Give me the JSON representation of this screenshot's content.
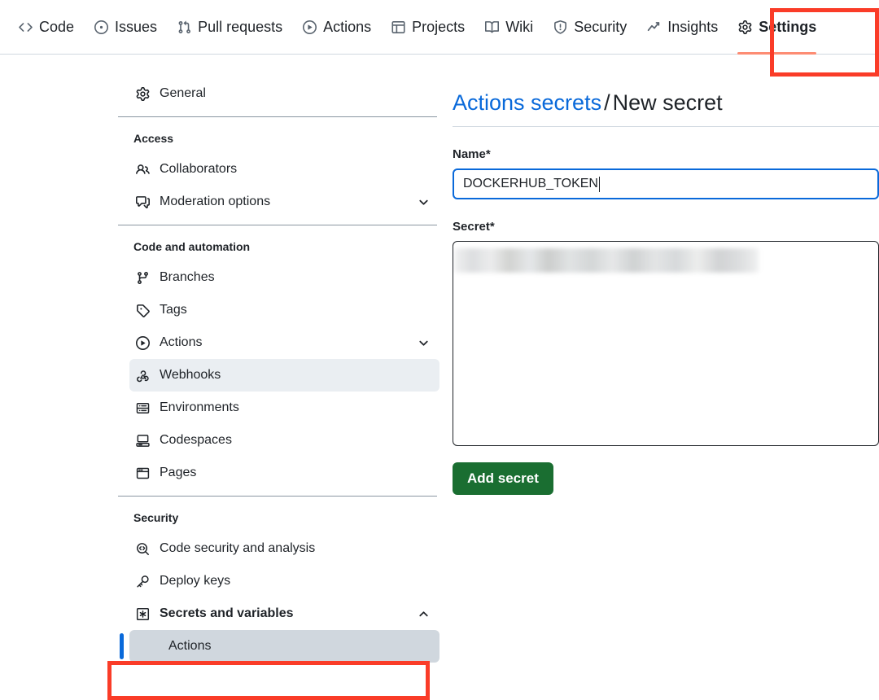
{
  "repo_nav": {
    "tabs": [
      {
        "label": "Code",
        "icon": "code-icon",
        "selected": false
      },
      {
        "label": "Issues",
        "icon": "issue-opened-icon",
        "selected": false
      },
      {
        "label": "Pull requests",
        "icon": "git-pull-request-icon",
        "selected": false
      },
      {
        "label": "Actions",
        "icon": "play-icon",
        "selected": false
      },
      {
        "label": "Projects",
        "icon": "table-icon",
        "selected": false
      },
      {
        "label": "Wiki",
        "icon": "book-icon",
        "selected": false
      },
      {
        "label": "Security",
        "icon": "shield-icon",
        "selected": false
      },
      {
        "label": "Insights",
        "icon": "graph-icon",
        "selected": false
      },
      {
        "label": "Settings",
        "icon": "gear-icon",
        "selected": true
      }
    ],
    "active_tab_underline_color": "#fd8c73"
  },
  "annotations": {
    "color": "#fa3c28",
    "boxes": [
      {
        "target": "Settings"
      },
      {
        "target": "Actions"
      }
    ]
  },
  "sidebar": {
    "top_item": {
      "label": "General",
      "icon": "gear-icon"
    },
    "groups": [
      {
        "title": "Access",
        "items": [
          {
            "label": "Collaborators",
            "icon": "people-icon",
            "chevron": "",
            "state": ""
          },
          {
            "label": "Moderation options",
            "icon": "comment-discussion-icon",
            "chevron": "down",
            "state": ""
          }
        ]
      },
      {
        "title": "Code and automation",
        "items": [
          {
            "label": "Branches",
            "icon": "git-branch-icon",
            "chevron": "",
            "state": ""
          },
          {
            "label": "Tags",
            "icon": "tag-icon",
            "chevron": "",
            "state": ""
          },
          {
            "label": "Actions",
            "icon": "play-icon",
            "chevron": "down",
            "state": ""
          },
          {
            "label": "Webhooks",
            "icon": "webhook-icon",
            "chevron": "",
            "state": "hovered"
          },
          {
            "label": "Environments",
            "icon": "server-icon",
            "chevron": "",
            "state": ""
          },
          {
            "label": "Codespaces",
            "icon": "codespaces-icon",
            "chevron": "",
            "state": ""
          },
          {
            "label": "Pages",
            "icon": "browser-icon",
            "chevron": "",
            "state": ""
          }
        ]
      },
      {
        "title": "Security",
        "items": [
          {
            "label": "Code security and analysis",
            "icon": "codescan-icon",
            "chevron": "",
            "state": ""
          },
          {
            "label": "Deploy keys",
            "icon": "key-icon",
            "chevron": "",
            "state": ""
          },
          {
            "label": "Secrets and variables",
            "icon": "asterisk-box-icon",
            "chevron": "up",
            "state": "bold"
          }
        ],
        "sub_items": [
          {
            "label": "Actions",
            "selected": true
          }
        ]
      }
    ],
    "selected_bar_color": "#0969da",
    "selected_bg_color": "#d0d7de",
    "hover_bg_color": "#eaeef2"
  },
  "main": {
    "breadcrumb": {
      "parent": "Actions secrets",
      "separator": "/",
      "current": "New secret"
    },
    "name_field": {
      "label": "Name",
      "required_mark": "*",
      "value": "DOCKERHUB_TOKEN",
      "focused": true
    },
    "secret_field": {
      "label": "Secret",
      "required_mark": "*",
      "value": "",
      "redacted": true
    },
    "submit_button": {
      "label": "Add secret",
      "color": "#1a6e31"
    }
  }
}
